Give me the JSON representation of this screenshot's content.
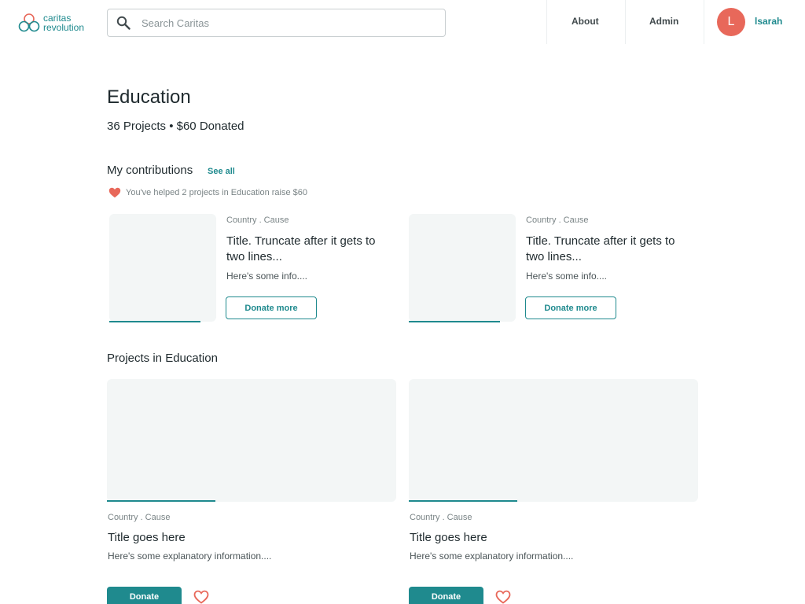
{
  "app": {
    "logo_line1": "caritas",
    "logo_line2": "revolution"
  },
  "search": {
    "placeholder": "Search Caritas",
    "value": ""
  },
  "nav": {
    "about": "About",
    "admin": "Admin"
  },
  "user": {
    "initial": "L",
    "name": "lsarah"
  },
  "page": {
    "title": "Education",
    "stats": "36 Projects • $60 Donated"
  },
  "contributions": {
    "heading": "My contributions",
    "see_all": "See all",
    "helped_text": "You've helped 2 projects in Education raise $60",
    "cards": [
      {
        "meta": "Country . Cause",
        "title": "Title. Truncate after it gets to two lines...",
        "info": "Here's some info....",
        "button": "Donate more",
        "progress": 0.85
      },
      {
        "meta": "Country . Cause",
        "title": "Title. Truncate after it gets to two lines...",
        "info": "Here's some info....",
        "button": "Donate more",
        "progress": 0.85
      }
    ]
  },
  "projects": {
    "heading": "Projects in Education",
    "cards": [
      {
        "meta": "Country . Cause",
        "title": "Title goes here",
        "info": "Here's some explanatory information....",
        "button": "Donate",
        "progress": 0.375
      },
      {
        "meta": "Country . Cause",
        "title": "Title goes here",
        "info": "Here's some explanatory information....",
        "button": "Donate",
        "progress": 0.375
      }
    ]
  },
  "colors": {
    "brand": "#1f8a8e",
    "avatar": "#e8685a",
    "heart": "#e8685a",
    "placeholder_bg": "#f3f6f6"
  },
  "icons": {
    "logo": "caritas-logo-icon",
    "search": "search-icon",
    "helped": "heart-filled-icon",
    "favorite": "heart-outline-icon"
  }
}
